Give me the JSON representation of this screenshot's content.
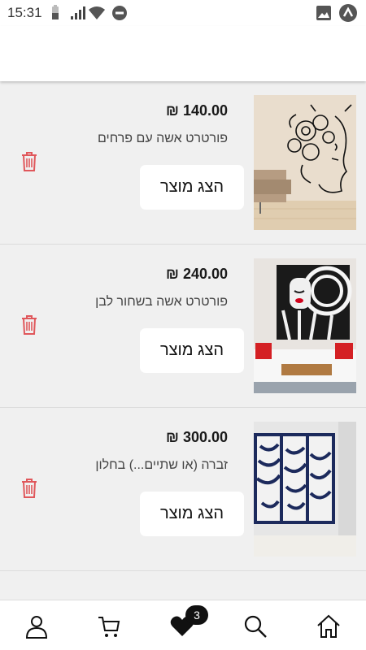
{
  "status_bar": {
    "time": "15:31"
  },
  "items": [
    {
      "price": "₪ 140.00",
      "title": "פורטרט אשה עם פרחים",
      "button_label": "הצג מוצר"
    },
    {
      "price": "₪ 240.00",
      "title": "פורטרט אשה בשחור לבן",
      "button_label": "הצג מוצר"
    },
    {
      "price": "₪ 300.00",
      "title": "זברה (או שתיים...) בחלון",
      "button_label": "הצג מוצר"
    }
  ],
  "bottom_nav": {
    "favorites_badge": "3",
    "icons": [
      "person-icon",
      "cart-icon",
      "heart-icon",
      "search-icon",
      "home-icon"
    ]
  },
  "colors": {
    "trash": "#e0575b",
    "badge": "#111111",
    "background": "#f0f0f0"
  }
}
